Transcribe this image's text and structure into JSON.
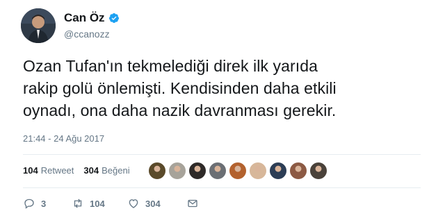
{
  "user": {
    "name": "Can Öz",
    "handle": "@ccanozz",
    "verified": true
  },
  "tweet": {
    "lines": [
      "Ozan Tufan'ın tekmelediği direk ilk yarıda",
      "rakip golü önlemişti. Kendisinden daha etkili",
      "oynadı, ona daha nazik davranması gerekir."
    ],
    "timestamp": "21:44 - 24 Ağu 2017"
  },
  "stats": {
    "retweets": "104",
    "retweets_label": "Retweet",
    "likes": "304",
    "likes_label": "Beğeni"
  },
  "actions": {
    "reply_count": "3",
    "retweet_count": "104",
    "like_count": "304"
  },
  "colors": {
    "verified_blue": "#1da1f2",
    "muted": "#657786",
    "text": "#14171a",
    "divider": "#e6ecf0"
  },
  "likers": [
    {
      "color": "#5a4a2a"
    },
    {
      "color": "#a7a39a"
    },
    {
      "color": "#2e2a28"
    },
    {
      "color": "#6b6f74"
    },
    {
      "color": "#b3622e"
    },
    {
      "color": "#d7b79a"
    },
    {
      "color": "#2c3d55"
    },
    {
      "color": "#8c5a44"
    },
    {
      "color": "#4a423a"
    }
  ]
}
